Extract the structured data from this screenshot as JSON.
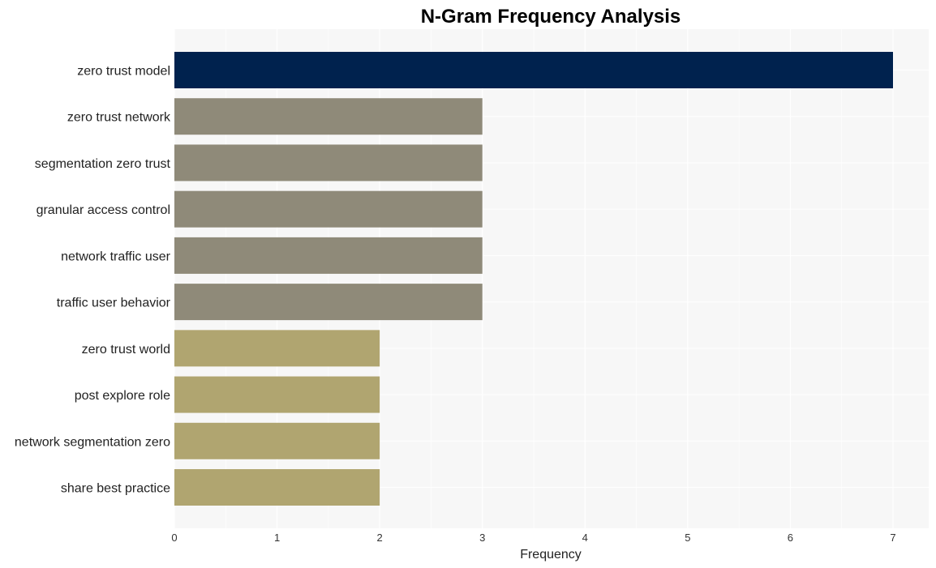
{
  "chart_data": {
    "type": "bar",
    "orientation": "horizontal",
    "title": "N-Gram Frequency Analysis",
    "xlabel": "Frequency",
    "ylabel": "",
    "xlim": [
      0,
      7.35
    ],
    "x_ticks": [
      0,
      1,
      2,
      3,
      4,
      5,
      6,
      7
    ],
    "grid": true,
    "categories": [
      "zero trust model",
      "zero trust network",
      "segmentation zero trust",
      "granular access control",
      "network traffic user",
      "traffic user behavior",
      "zero trust world",
      "post explore role",
      "network segmentation zero",
      "share best practice"
    ],
    "values": [
      7,
      3,
      3,
      3,
      3,
      3,
      2,
      2,
      2,
      2
    ],
    "colors": [
      "#00224e",
      "#8f8a79",
      "#8f8a79",
      "#8f8a79",
      "#8f8a79",
      "#8f8a79",
      "#b0a570",
      "#b0a570",
      "#b0a570",
      "#b0a570"
    ],
    "background": "#f7f7f7",
    "gridline_color": "#ffffff"
  }
}
